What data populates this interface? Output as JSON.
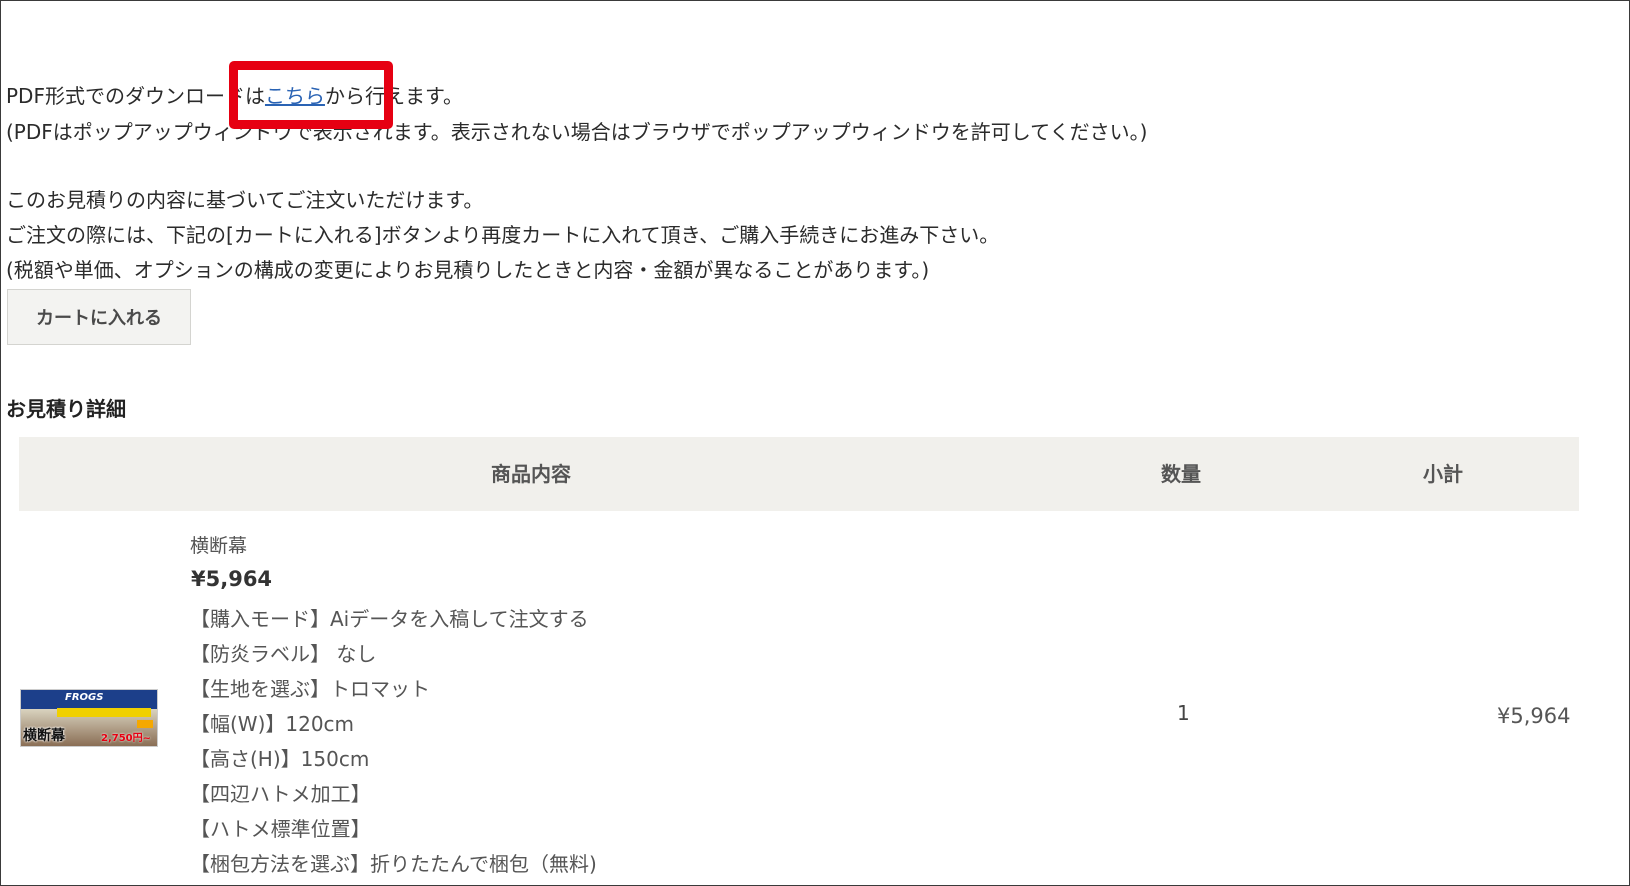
{
  "pdf_notice": {
    "prefix": "PDF形式でのダウンロードは",
    "link_label": "こちら",
    "suffix": "から行えます。",
    "popup_note": "(PDFはポップアップウィンドウで表示されます。表示されない場合はブラウザでポップアップウィンドウを許可してください。)"
  },
  "order_notice": {
    "line1": "このお見積りの内容に基づいてご注文いただけます。",
    "line2": "ご注文の際には、下記の[カートに入れる]ボタンより再度カートに入れて頂き、ご購入手続きにお進み下さい。",
    "line3": "(税額や単価、オプションの構成の変更によりお見積りしたときと内容・金額が異なることがあります。)"
  },
  "cart_button_label": "カートに入れる",
  "details_title": "お見積り詳細",
  "table": {
    "headers": {
      "product": "商品内容",
      "quantity": "数量",
      "subtotal": "小計"
    },
    "rows": [
      {
        "thumbnail": {
          "banner_text": "FROGS",
          "label": "横断幕",
          "price_text": "2,750円~"
        },
        "name": "横断幕",
        "price": "¥5,964",
        "options": [
          "【購入モード】Aiデータを入稿して注文する",
          "【防炎ラベル】 なし",
          "【生地を選ぶ】トロマット",
          "【幅(W)】120cm",
          "【高さ(H)】150cm",
          "【四辺ハトメ加工】",
          "【ハトメ標準位置】",
          "【梱包方法を選ぶ】折りたたんで梱包（無料)"
        ],
        "quantity": "1",
        "subtotal": "¥5,964"
      }
    ]
  },
  "colors": {
    "highlight_border": "#e60012",
    "link": "#2a63b4",
    "header_bg": "#f1f0ec"
  }
}
